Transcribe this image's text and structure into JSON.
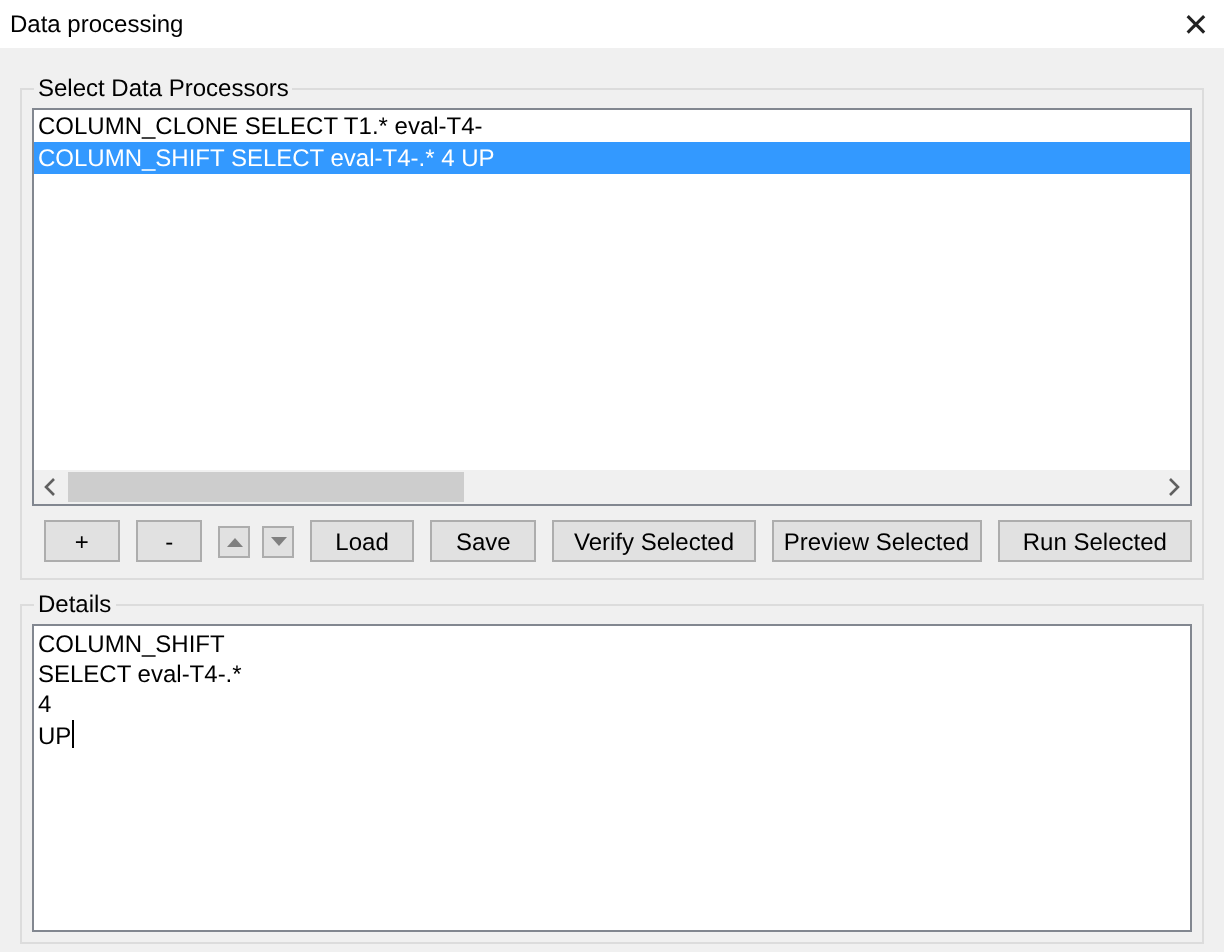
{
  "window": {
    "title": "Data processing",
    "close": "✕"
  },
  "processors": {
    "title": "Select Data Processors",
    "items": [
      {
        "label": "COLUMN_CLONE SELECT T1.* eval-T4-",
        "selected": false
      },
      {
        "label": "COLUMN_SHIFT SELECT eval-T4-.* 4 UP",
        "selected": true
      }
    ]
  },
  "buttons": [
    {
      "kind": "text",
      "label": "+"
    },
    {
      "kind": "text",
      "label": "-"
    },
    {
      "kind": "up"
    },
    {
      "kind": "down"
    },
    {
      "kind": "text",
      "label": "Load"
    },
    {
      "kind": "text",
      "label": "Save"
    },
    {
      "kind": "text",
      "label": "Verify Selected"
    },
    {
      "kind": "text",
      "label": "Preview Selected"
    },
    {
      "kind": "text",
      "label": "Run Selected"
    }
  ],
  "details": {
    "title": "Details",
    "lines": [
      "COLUMN_SHIFT",
      "SELECT eval-T4-.*",
      "4",
      "UP"
    ]
  }
}
